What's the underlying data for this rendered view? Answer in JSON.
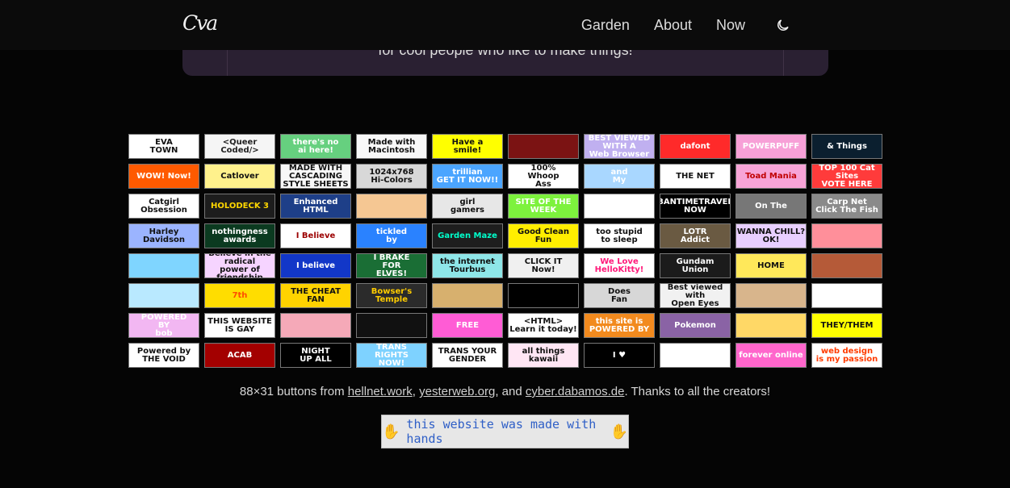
{
  "nav": {
    "logo": "Cva",
    "links": [
      "Garden",
      "About",
      "Now"
    ],
    "theme_icon": "moon-icon"
  },
  "hero": {
    "text": "for cool people who like to make things!"
  },
  "buttons": [
    {
      "label": "EVA\nTOWN",
      "bg": "#ffffff",
      "fg": "#111111"
    },
    {
      "label": "<Queer\nCoded/>",
      "bg": "#f5f5f5",
      "fg": "#222222"
    },
    {
      "label": "there's no\nai here!",
      "bg": "#66d07f",
      "fg": "#ffffff"
    },
    {
      "label": "Made with\nMacintosh",
      "bg": "#f8f8f8",
      "fg": "#111111"
    },
    {
      "label": "Have a\nsmile!",
      "bg": "#ffff00",
      "fg": "#111111"
    },
    {
      "label": "",
      "bg": "#7b1313",
      "fg": "#ffffff"
    },
    {
      "label": "BEST VIEWED\nWITH A\nWeb Browser",
      "bg": "#c0b0f0",
      "fg": "#ffffff"
    },
    {
      "label": "dafont",
      "bg": "#ff2a2a",
      "fg": "#ffffff"
    },
    {
      "label": "POWERPUFF",
      "bg": "#f7a0d7",
      "fg": "#ffffff"
    },
    {
      "label": "& Things",
      "bg": "#0b1f2f",
      "fg": "#ffffff"
    },
    {
      "label": "WOW! Now!",
      "bg": "#ff5a00",
      "fg": "#ffffff"
    },
    {
      "label": "Catlover",
      "bg": "#fff18c",
      "fg": "#111111"
    },
    {
      "label": "MADE WITH\nCASCADING\nSTYLE SHEETS",
      "bg": "#f7f7f7",
      "fg": "#111111"
    },
    {
      "label": "1024x768\nHi-Colors",
      "bg": "#d8d8d8",
      "fg": "#111111"
    },
    {
      "label": "trillian\nGET IT NOW!!",
      "bg": "#4ba5ff",
      "fg": "#ffffff"
    },
    {
      "label": "100%\nWhoop\nAss",
      "bg": "#ffffff",
      "fg": "#111111"
    },
    {
      "label": "and\nMy",
      "bg": "#a9d7ff",
      "fg": "#ffffff"
    },
    {
      "label": "THE NET",
      "bg": "#ffffff",
      "fg": "#111111"
    },
    {
      "label": "Toad Mania",
      "bg": "#f7a4d7",
      "fg": "#c00000"
    },
    {
      "label": "TOP 100 Cat Sites\nVOTE HERE",
      "bg": "#ff3b3b",
      "fg": "#ffffff"
    },
    {
      "label": "Catgirl Obsession",
      "bg": "#ffffff",
      "fg": "#111111"
    },
    {
      "label": "HOLODECK 3",
      "bg": "#1d1d1d",
      "fg": "#ffd700"
    },
    {
      "label": "Enhanced\nHTML",
      "bg": "#1e3f88",
      "fg": "#ffffff"
    },
    {
      "label": "",
      "bg": "#f5c793",
      "fg": "#000000"
    },
    {
      "label": "girl\ngamers",
      "bg": "#e7e7e7",
      "fg": "#111111"
    },
    {
      "label": "SITE OF THE WEEK",
      "bg": "#7df23d",
      "fg": "#ffffff"
    },
    {
      "label": "",
      "bg": "#ffffff",
      "fg": "#111111"
    },
    {
      "label": "BANTIMETRAVEL\nNOW",
      "bg": "#000000",
      "fg": "#ffffff"
    },
    {
      "label": "On The",
      "bg": "#777777",
      "fg": "#ffffff"
    },
    {
      "label": "Carp Net\nClick The Fish",
      "bg": "#8a8a8a",
      "fg": "#ffffff"
    },
    {
      "label": "Harley\nDavidson",
      "bg": "#9bb4ff",
      "fg": "#111111"
    },
    {
      "label": "nothingness\nawards",
      "bg": "#0b3a20",
      "fg": "#ffffff"
    },
    {
      "label": "I Believe",
      "bg": "#ffffff",
      "fg": "#9b0000"
    },
    {
      "label": "tickled\nby",
      "bg": "#2a82ff",
      "fg": "#ffffff"
    },
    {
      "label": "Garden Maze",
      "bg": "#1e1e1e",
      "fg": "#00ffcc"
    },
    {
      "label": "Good Clean Fun",
      "bg": "#ffee00",
      "fg": "#111111"
    },
    {
      "label": "too stupid\nto sleep",
      "bg": "#ffffff",
      "fg": "#111111"
    },
    {
      "label": "LOTR\nAddict",
      "bg": "#6a5a42",
      "fg": "#ffffff"
    },
    {
      "label": "WANNA CHILL?\nOK!",
      "bg": "#e8cfff",
      "fg": "#111111"
    },
    {
      "label": "",
      "bg": "#ff8f9a",
      "fg": "#ffffff"
    },
    {
      "label": "",
      "bg": "#7fd5ff",
      "fg": "#ffffff"
    },
    {
      "label": "Believe in the radical\npower of friendship",
      "bg": "#f6d4ff",
      "fg": "#111111"
    },
    {
      "label": "I believe",
      "bg": "#1237c8",
      "fg": "#ffffff"
    },
    {
      "label": "I BRAKE\nFOR\nELVES!",
      "bg": "#1a6e35",
      "fg": "#ffffff"
    },
    {
      "label": "the internet\nTourbus",
      "bg": "#8ee6e8",
      "fg": "#111111"
    },
    {
      "label": "CLICK IT\nNow!",
      "bg": "#f0f0f0",
      "fg": "#111111"
    },
    {
      "label": "We Love\nHelloKitty!",
      "bg": "#ffffff",
      "fg": "#ff1a7a"
    },
    {
      "label": "Gundam\nUnion",
      "bg": "#1b1b1b",
      "fg": "#ffffff"
    },
    {
      "label": "HOME",
      "bg": "#ffe85a",
      "fg": "#111111"
    },
    {
      "label": "",
      "bg": "#b55a38",
      "fg": "#ffffff"
    },
    {
      "label": "",
      "bg": "#b9e9ff",
      "fg": "#ffffff"
    },
    {
      "label": "7th",
      "bg": "#ffdd00",
      "fg": "#ff4b00"
    },
    {
      "label": "THE CHEAT FAN",
      "bg": "#ffd300",
      "fg": "#111111"
    },
    {
      "label": "Bowser's\nTemple",
      "bg": "#2b2b2b",
      "fg": "#ffcc00"
    },
    {
      "label": "",
      "bg": "#d7b06e",
      "fg": "#111111"
    },
    {
      "label": "",
      "bg": "#000000",
      "fg": "#ffffff"
    },
    {
      "label": "Does\nFan",
      "bg": "#d7d7d7",
      "fg": "#111111"
    },
    {
      "label": "Best viewed with\nOpen Eyes",
      "bg": "#f1f1f1",
      "fg": "#111111"
    },
    {
      "label": "",
      "bg": "#d8b58c",
      "fg": "#111111"
    },
    {
      "label": "",
      "bg": "#ffffff",
      "fg": "#111111"
    },
    {
      "label": "POWERED\nBY\nbob",
      "bg": "#f2b7f2",
      "fg": "#ffffff"
    },
    {
      "label": "THIS WEBSITE\nIS GAY",
      "bg": "#ffffff",
      "fg": "#111111"
    },
    {
      "label": "",
      "bg": "#f5a9b8",
      "fg": "#ffffff"
    },
    {
      "label": "",
      "bg": "#111111",
      "fg": "#ffffff"
    },
    {
      "label": "FREE",
      "bg": "#ff5cd5",
      "fg": "#ffffff"
    },
    {
      "label": "<HTML>\nLearn it today!",
      "bg": "#ffffff",
      "fg": "#111111"
    },
    {
      "label": "this site is\nPOWERED BY",
      "bg": "#f28a1e",
      "fg": "#ffffff"
    },
    {
      "label": "Pokemon",
      "bg": "#8a63a5",
      "fg": "#ffffff"
    },
    {
      "label": "",
      "bg": "#ffd866",
      "fg": "#111111"
    },
    {
      "label": "THEY/THEM",
      "bg": "#ffff00",
      "fg": "#111111"
    },
    {
      "label": "Powered by\nTHE VOID",
      "bg": "#ffffff",
      "fg": "#111111"
    },
    {
      "label": "ACAB",
      "bg": "#a30000",
      "fg": "#ffffff"
    },
    {
      "label": "NIGHT\nUP ALL",
      "bg": "#000000",
      "fg": "#ffffff"
    },
    {
      "label": "TRANS\nRIGHTS\nNOW!",
      "bg": "#7ed2ff",
      "fg": "#ffffff"
    },
    {
      "label": "TRANS YOUR\nGENDER",
      "bg": "#ffffff",
      "fg": "#111111"
    },
    {
      "label": "all things\nkawaii",
      "bg": "#ffe6f4",
      "fg": "#111111"
    },
    {
      "label": "I ♥",
      "bg": "#000000",
      "fg": "#ffffff"
    },
    {
      "label": "",
      "bg": "#ffffff",
      "fg": "#111111"
    },
    {
      "label": "forever online",
      "bg": "#ff66cc",
      "fg": "#ffffff"
    },
    {
      "label": "web design\nis my passion",
      "bg": "#ffffff",
      "fg": "#ff3b00"
    }
  ],
  "credits": {
    "prefix": "88×31 buttons from ",
    "link1": "hellnet.work",
    "sep1": ", ",
    "link2": "yesterweb.org",
    "sep2": ", and ",
    "link3": "cyber.dabamos.de",
    "suffix": ". Thanks to all the creators!"
  },
  "hands_banner": {
    "text": "this website was made with hands"
  }
}
